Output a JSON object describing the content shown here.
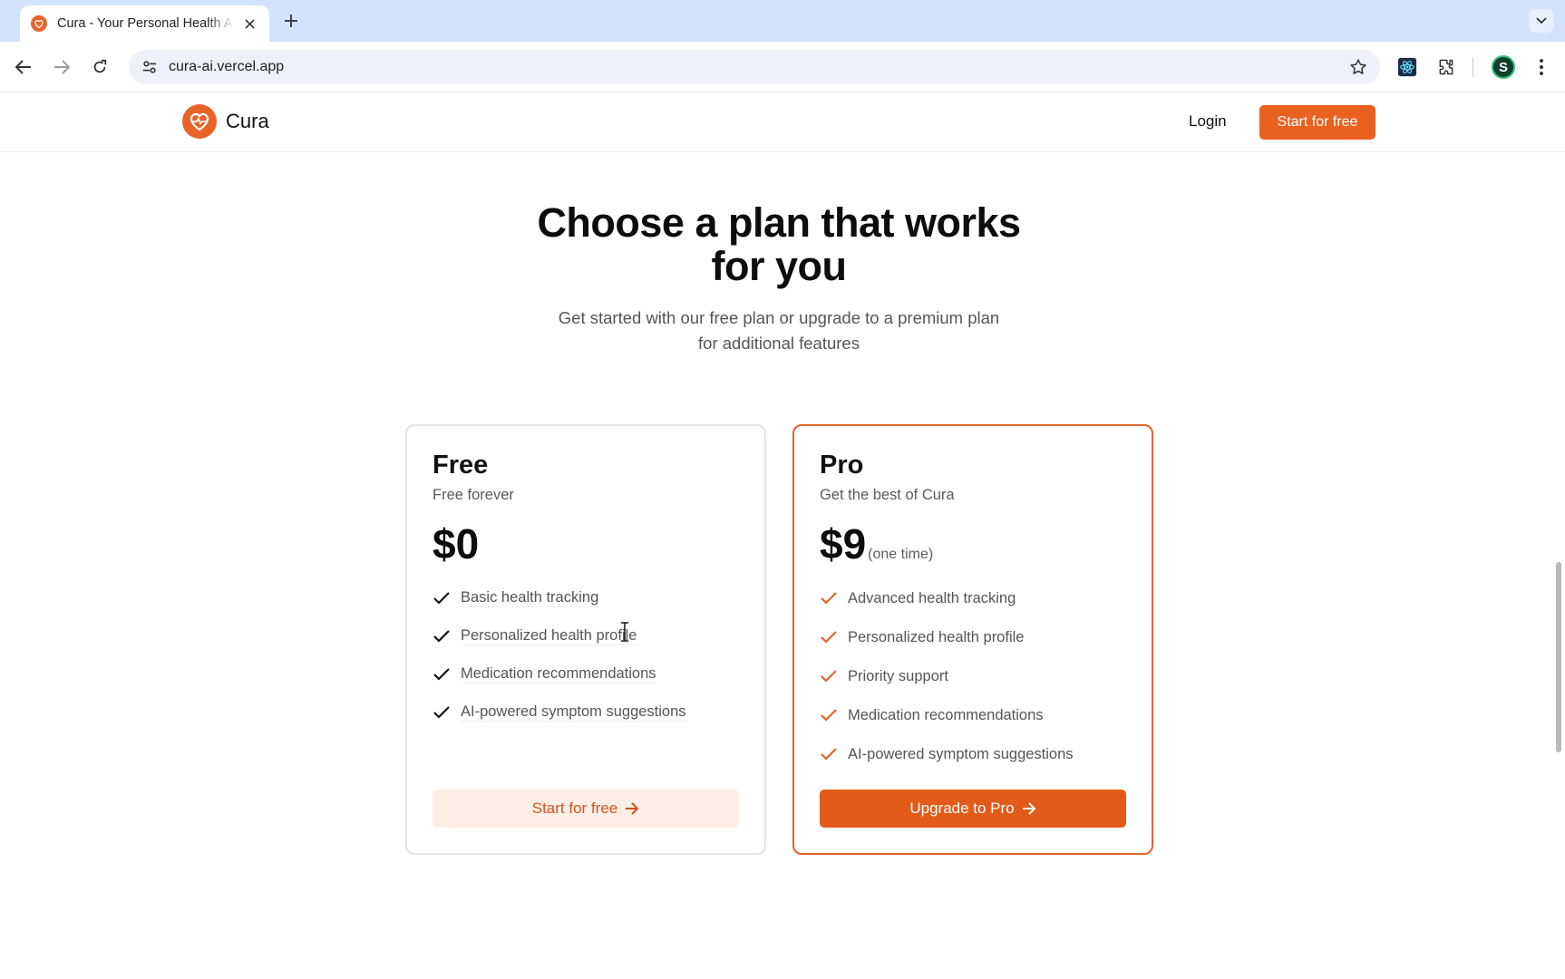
{
  "browser": {
    "tab_title": "Cura - Your Personal Health Assistant",
    "url": "cura-ai.vercel.app",
    "profile_initial": "S"
  },
  "header": {
    "brand": "Cura",
    "login": "Login",
    "cta": "Start for free"
  },
  "hero": {
    "title_line1": "Choose a plan that works",
    "title_line2": "for you",
    "subtitle_line1": "Get started with our free plan or upgrade to a premium plan",
    "subtitle_line2": "for additional features"
  },
  "plans": {
    "free": {
      "name": "Free",
      "tagline": "Free forever",
      "price": "$0",
      "features": [
        "Basic health tracking",
        "Personalized health profile",
        "Medication recommendations",
        "AI-powered symptom suggestions"
      ],
      "button": "Start for free"
    },
    "pro": {
      "name": "Pro",
      "tagline": "Get the best of Cura",
      "price": "$9",
      "price_note": "(one time)",
      "features": [
        "Advanced health tracking",
        "Personalized health profile",
        "Priority support",
        "Medication recommendations",
        "AI-powered symptom suggestions"
      ],
      "button": "Upgrade to Pro"
    }
  },
  "colors": {
    "accent": "#e8611f",
    "accent_light": "#fdeee6",
    "check_dark": "#111111",
    "check_accent": "#e0652a"
  },
  "icons": {
    "brand": "heart-pulse-icon",
    "check": "check-icon",
    "arrow": "arrow-right-icon"
  }
}
